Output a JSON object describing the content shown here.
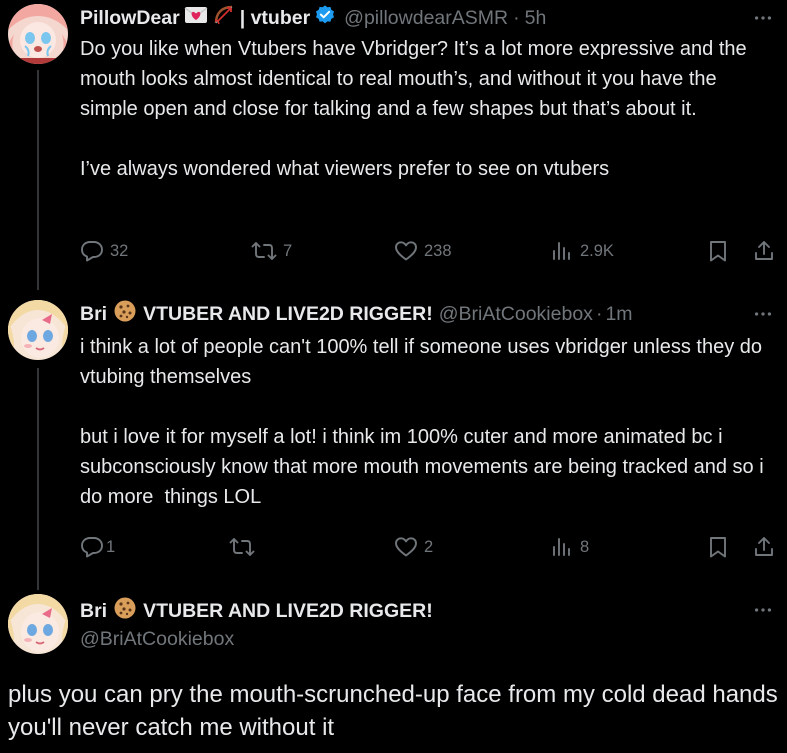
{
  "posts": [
    {
      "display_name": "PillowDear",
      "name_suffix": "| vtuber",
      "handle": "@pillowdearASMR",
      "time": "5h",
      "body": "Do you like when Vtubers have Vbridger? It’s a lot more expressive and the mouth looks almost identical to real mouth’s, and without it you have the simple open and close for talking and a few shapes but that’s about it.\n\nI’ve always wondered what viewers prefer to see on vtubers",
      "replies": "32",
      "reposts": "7",
      "likes": "238",
      "views": "2.9K",
      "icons": [
        "love-letter-emoji",
        "bow-and-arrow-emoji",
        "verified-badge-icon"
      ]
    },
    {
      "display_name": "Bri",
      "name_suffix": "VTUBER AND LIVE2D RIGGER!",
      "handle": "@BriAtCookiebox",
      "time": "1m",
      "body": "i think a lot of people can't 100% tell if someone uses vbridger unless they do vtubing themselves\n\nbut i love it for myself a lot! i think im 100% cuter and more animated bc i subconsciously know that more mouth movements are being tracked and so i do more  things LOL",
      "replies": "1",
      "reposts": "",
      "likes": "2",
      "views": "8",
      "icons": [
        "cookie-emoji"
      ]
    }
  ],
  "focus_post": {
    "display_name": "Bri",
    "name_suffix": "VTUBER AND LIVE2D RIGGER!",
    "handle": "@BriAtCookiebox",
    "body": "plus you can pry the mouth-scrunched-up face from my cold dead hands you'll never catch me without it"
  },
  "colors": {
    "background": "#000000",
    "text": "#e7e9ea",
    "muted": "#71767b",
    "verified": "#1d9bf0"
  }
}
